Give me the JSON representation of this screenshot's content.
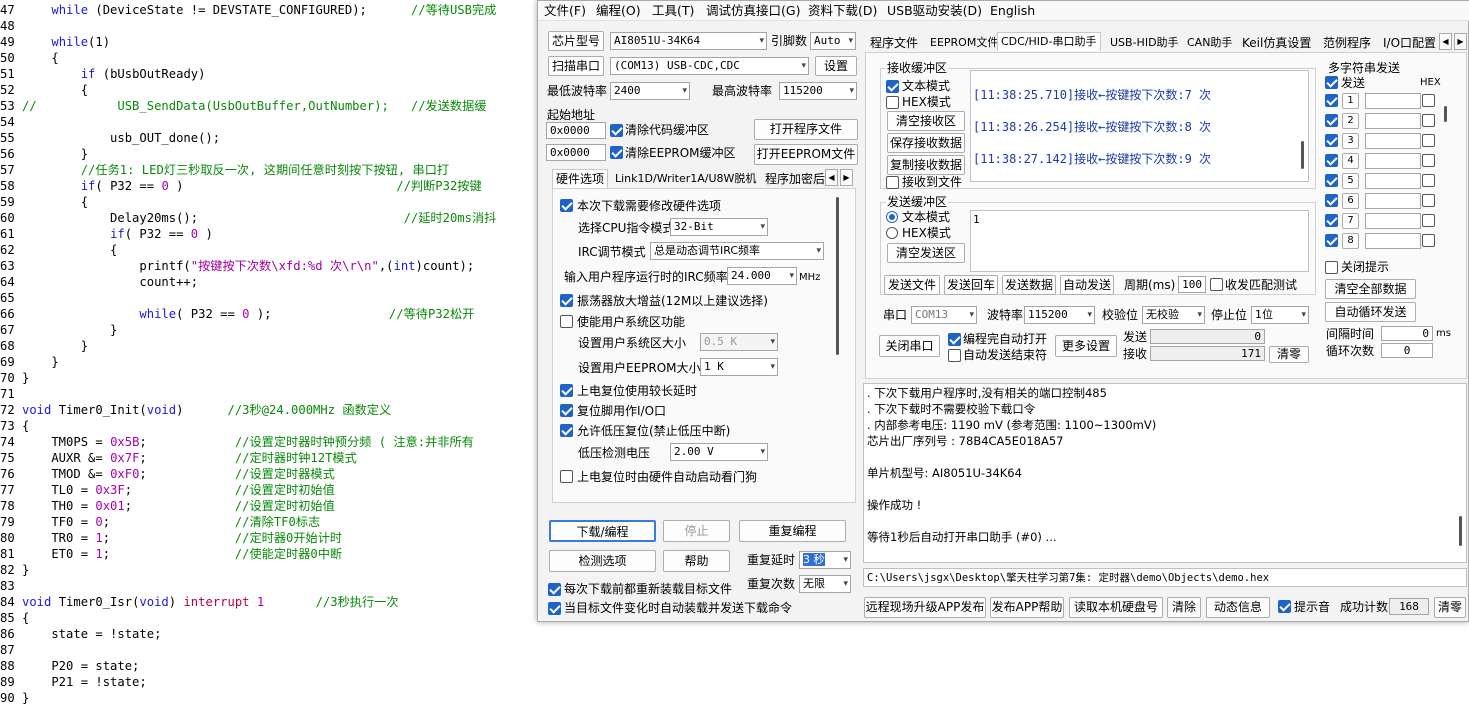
{
  "code": [
    {
      "n": "47",
      "p": [
        {
          "t": "    "
        },
        {
          "t": "while",
          "c": "kw"
        },
        {
          "t": " (DeviceState != DEVSTATE_CONFIGURED);      "
        },
        {
          "t": "//等待USB完成",
          "c": "cm"
        }
      ]
    },
    {
      "n": "48",
      "p": []
    },
    {
      "n": "49",
      "p": [
        {
          "t": "    "
        },
        {
          "t": "while",
          "c": "kw"
        },
        {
          "t": "(1)"
        }
      ]
    },
    {
      "n": "50",
      "p": [
        {
          "t": "    {"
        }
      ]
    },
    {
      "n": "51",
      "p": [
        {
          "t": "        "
        },
        {
          "t": "if",
          "c": "kw"
        },
        {
          "t": " (bUsbOutReady)"
        }
      ]
    },
    {
      "n": "52",
      "p": [
        {
          "t": "        {"
        }
      ]
    },
    {
      "n": "53",
      "p": [
        {
          "t": "//           USB_SendData(UsbOutBuffer,OutNumber);   //发送数据缓",
          "c": "cm"
        }
      ]
    },
    {
      "n": "54",
      "p": []
    },
    {
      "n": "55",
      "p": [
        {
          "t": "            usb_OUT_done();"
        }
      ]
    },
    {
      "n": "56",
      "p": [
        {
          "t": "        }"
        }
      ]
    },
    {
      "n": "57",
      "p": [
        {
          "t": "        "
        },
        {
          "t": "//任务1: LED灯三秒取反一次, 这期间任意时刻按下按钮, 串口打",
          "c": "cm"
        }
      ]
    },
    {
      "n": "58",
      "p": [
        {
          "t": "        "
        },
        {
          "t": "if",
          "c": "kw"
        },
        {
          "t": "( P32 == "
        },
        {
          "t": "0",
          "c": "num"
        },
        {
          "t": " )                             "
        },
        {
          "t": "//判断P32按键",
          "c": "cm"
        }
      ]
    },
    {
      "n": "59",
      "p": [
        {
          "t": "        {"
        }
      ]
    },
    {
      "n": "60",
      "p": [
        {
          "t": "            Delay20ms();                            "
        },
        {
          "t": "//延时20ms消抖",
          "c": "cm"
        }
      ]
    },
    {
      "n": "61",
      "p": [
        {
          "t": "            "
        },
        {
          "t": "if",
          "c": "kw"
        },
        {
          "t": "( P32 == "
        },
        {
          "t": "0",
          "c": "num"
        },
        {
          "t": " )"
        }
      ]
    },
    {
      "n": "62",
      "p": [
        {
          "t": "            {"
        }
      ]
    },
    {
      "n": "63",
      "p": [
        {
          "t": "                printf("
        },
        {
          "t": "\"按键按下次数\\xfd:%d 次\\r\\n\"",
          "c": "st"
        },
        {
          "t": ",("
        },
        {
          "t": "int",
          "c": "kw"
        },
        {
          "t": ")count);"
        }
      ]
    },
    {
      "n": "64",
      "p": [
        {
          "t": "                count++;"
        }
      ]
    },
    {
      "n": "65",
      "p": []
    },
    {
      "n": "66",
      "p": [
        {
          "t": "                "
        },
        {
          "t": "while",
          "c": "kw"
        },
        {
          "t": "( P32 == "
        },
        {
          "t": "0",
          "c": "num"
        },
        {
          "t": " );                "
        },
        {
          "t": "//等待P32松开",
          "c": "cm"
        }
      ]
    },
    {
      "n": "67",
      "p": [
        {
          "t": "            }"
        }
      ]
    },
    {
      "n": "68",
      "p": [
        {
          "t": "        }"
        }
      ]
    },
    {
      "n": "69",
      "p": [
        {
          "t": "    }"
        }
      ]
    },
    {
      "n": "70",
      "p": [
        {
          "t": "}"
        }
      ]
    },
    {
      "n": "71",
      "p": []
    },
    {
      "n": "72",
      "p": [
        {
          "t": "void",
          "c": "kw"
        },
        {
          "t": " Timer0_Init("
        },
        {
          "t": "void",
          "c": "kw"
        },
        {
          "t": ")      "
        },
        {
          "t": "//3秒@24.000MHz 函数定义",
          "c": "cm"
        }
      ]
    },
    {
      "n": "73",
      "p": [
        {
          "t": "{"
        }
      ]
    },
    {
      "n": "74",
      "p": [
        {
          "t": "    TM0PS = "
        },
        {
          "t": "0x5B",
          "c": "num"
        },
        {
          "t": ";            "
        },
        {
          "t": "//设置定时器时钟预分频 ( 注意:并非所有",
          "c": "cm"
        }
      ]
    },
    {
      "n": "75",
      "p": [
        {
          "t": "    AUXR &= "
        },
        {
          "t": "0x7F",
          "c": "num"
        },
        {
          "t": ";            "
        },
        {
          "t": "//定时器时钟12T模式",
          "c": "cm"
        }
      ]
    },
    {
      "n": "76",
      "p": [
        {
          "t": "    TMOD &= "
        },
        {
          "t": "0xF0",
          "c": "num"
        },
        {
          "t": ";            "
        },
        {
          "t": "//设置定时器模式",
          "c": "cm"
        }
      ]
    },
    {
      "n": "77",
      "p": [
        {
          "t": "    TL0 = "
        },
        {
          "t": "0x3F",
          "c": "num"
        },
        {
          "t": ";              "
        },
        {
          "t": "//设置定时初始值",
          "c": "cm"
        }
      ]
    },
    {
      "n": "78",
      "p": [
        {
          "t": "    TH0 = "
        },
        {
          "t": "0x01",
          "c": "num"
        },
        {
          "t": ";              "
        },
        {
          "t": "//设置定时初始值",
          "c": "cm"
        }
      ]
    },
    {
      "n": "79",
      "p": [
        {
          "t": "    TF0 = "
        },
        {
          "t": "0",
          "c": "num"
        },
        {
          "t": ";                 "
        },
        {
          "t": "//清除TF0标志",
          "c": "cm"
        }
      ]
    },
    {
      "n": "80",
      "p": [
        {
          "t": "    TR0 = "
        },
        {
          "t": "1",
          "c": "num"
        },
        {
          "t": ";                 "
        },
        {
          "t": "//定时器0开始计时",
          "c": "cm"
        }
      ]
    },
    {
      "n": "81",
      "p": [
        {
          "t": "    ET0 = "
        },
        {
          "t": "1",
          "c": "num"
        },
        {
          "t": ";                 "
        },
        {
          "t": "//使能定时器0中断",
          "c": "cm"
        }
      ]
    },
    {
      "n": "82",
      "p": [
        {
          "t": "}"
        }
      ]
    },
    {
      "n": "83",
      "p": []
    },
    {
      "n": "84",
      "p": [
        {
          "t": "void",
          "c": "kw"
        },
        {
          "t": " Timer0_Isr("
        },
        {
          "t": "void",
          "c": "kw"
        },
        {
          "t": ") "
        },
        {
          "t": "interrupt",
          "c": "kr"
        },
        {
          "t": " "
        },
        {
          "t": "1",
          "c": "num"
        },
        {
          "t": "       "
        },
        {
          "t": "//3秒执行一次",
          "c": "cm"
        }
      ]
    },
    {
      "n": "85",
      "p": [
        {
          "t": "{"
        }
      ]
    },
    {
      "n": "86",
      "p": [
        {
          "t": "    state = !state;"
        }
      ]
    },
    {
      "n": "87",
      "p": []
    },
    {
      "n": "88",
      "p": [
        {
          "t": "    P20 = state;"
        }
      ]
    },
    {
      "n": "89",
      "p": [
        {
          "t": "    P21 = !state;"
        }
      ]
    },
    {
      "n": "90",
      "p": [
        {
          "t": "}"
        }
      ]
    }
  ],
  "menu": [
    "文件(F)",
    "编程(O)",
    "工具(T)",
    "调试仿真接口(G)",
    "资料下载(D)",
    "USB驱动安装(D)",
    "English"
  ],
  "left": {
    "chip_label": "芯片型号",
    "chip_value": "AI8051U-34K64",
    "pin_label": "引脚数",
    "pin_value": "Auto",
    "scan_label": "扫描串口",
    "port_value": "(COM13) USB-CDC,CDC",
    "settings_label": "设置",
    "min_baud_label": "最低波特率",
    "min_baud": "2400",
    "max_baud_label": "最高波特率",
    "max_baud": "115200",
    "start_addr_label": "起始地址",
    "addr1": "0x0000",
    "clear_code": "清除代码缓冲区",
    "open_prog": "打开程序文件",
    "addr2": "0x0000",
    "clear_eeprom": "清除EEPROM缓冲区",
    "open_eeprom": "打开EEPROM文件",
    "tabs": [
      "硬件选项",
      "Link1D/Writer1A/U8W脱机",
      "程序加密后"
    ],
    "opts": {
      "modify_hw": "本次下载需要修改硬件选项",
      "cpu_mode_label": "选择CPU指令模式",
      "cpu_mode": "32-Bit",
      "irc_label": "IRC调节模式",
      "irc_value": "总是动态调节IRC频率",
      "freq_label": "输入用户程序运行时的IRC频率",
      "freq_value": "24.000",
      "freq_unit": "MHz",
      "osc_gain": "振荡器放大增益(12M以上建议选择)",
      "user_sys": "使能用户系统区功能",
      "sys_size_label": "设置用户系统区大小",
      "sys_size": "0.5 K",
      "eeprom_size_label": "设置用户EEPROM大小",
      "eeprom_size": "1   K",
      "long_delay": "上电复位使用较长延时",
      "reset_io": "复位脚用作I/O口",
      "low_volt": "允许低压复位(禁止低压中断)",
      "volt_label": "低压检测电压",
      "volt_value": "2.00 V",
      "watchdog": "上电复位时由硬件自动启动看门狗"
    },
    "download": "下载/编程",
    "stop": "停止",
    "reprogram": "重复编程",
    "detect": "检测选项",
    "help": "帮助",
    "repeat_delay_label": "重复延时",
    "repeat_delay": "3 秒",
    "repeat_count_label": "重复次数",
    "repeat_count": "无限",
    "reload_each": "每次下载前都重新装载目标文件",
    "auto_reload": "当目标文件变化时自动装载并发送下载命令"
  },
  "right": {
    "tabs": [
      "程序文件",
      "EEPROM文件",
      "CDC/HID-串口助手",
      "USB-HID助手",
      "CAN助手",
      "Keil仿真设置",
      "范例程序",
      "I/O口配置"
    ],
    "rx_group": "接收缓冲区",
    "text_mode": "文本模式",
    "hex_mode": "HEX模式",
    "clear_rx": "清空接收区",
    "save_rx": "保存接收数据",
    "copy_rx": "复制接收数据",
    "rx_to_file": "接收到文件",
    "rx_lines": [
      "[11:38:25.710]接收←按键按下次数:7 次",
      "[11:38:26.254]接收←按键按下次数:8 次",
      "[11:38:27.142]接收←按键按下次数:9 次"
    ],
    "tx_group": "发送缓冲区",
    "tx_text_mode": "文本模式",
    "tx_hex_mode": "HEX模式",
    "clear_tx": "清空发送区",
    "tx_value": "1",
    "send_file": "发送文件",
    "send_enter": "发送回车",
    "send_data": "发送数据",
    "auto_send": "自动发送",
    "period_label": "周期(ms)",
    "period": "100",
    "match_test": "收发匹配测试",
    "port_label": "串口",
    "port": "COM13",
    "baud_label": "波特率",
    "baud": "115200",
    "parity_label": "校验位",
    "parity": "无校验",
    "stop_label": "停止位",
    "stop": "1位",
    "close_port": "关闭串口",
    "auto_open": "编程完自动打开",
    "auto_send_end": "自动发送结束符",
    "more_settings": "更多设置",
    "send_label": "发送",
    "send_count": "0",
    "recv_label": "接收",
    "recv_count": "171",
    "clear_counts": "清零",
    "multi_title": "多字符串发送",
    "send_col": "发送",
    "hex_col": "HEX",
    "rows": [
      "1",
      "2",
      "3",
      "4",
      "5",
      "6",
      "7",
      "8"
    ],
    "close_hint": "关闭提示",
    "clear_all": "清空全部数据",
    "auto_loop": "自动循环发送",
    "interval_label": "间隔时间",
    "interval": "0",
    "interval_unit": "ms",
    "loop_label": "循环次数",
    "loop": "0"
  },
  "log": [
    ". 下次下载用户程序时,没有相关的端口控制485",
    ". 下次下载时不需要校验下载口令",
    ". 内部参考电压: 1190 mV (参考范围: 1100~1300mV)",
    "芯片出厂序列号 : 78B4CA5E018A57",
    "",
    "  单片机型号: AI8051U-34K64",
    "",
    "操作成功 !",
    "",
    "等待1秒后自动打开串口助手 (#0) ..."
  ],
  "path": "C:\\Users\\jsgx\\Desktop\\擎天柱学习第7集: 定时器\\demo\\Objects\\demo.hex",
  "bottom": {
    "remote_upgrade": "远程现场升级APP发布",
    "publish_help": "发布APP帮助",
    "read_disk": "读取本机硬盘号",
    "clear": "清除",
    "dynamic_info": "动态信息",
    "sound": "提示音",
    "success_label": "成功计数",
    "success": "168",
    "reset": "清零"
  }
}
